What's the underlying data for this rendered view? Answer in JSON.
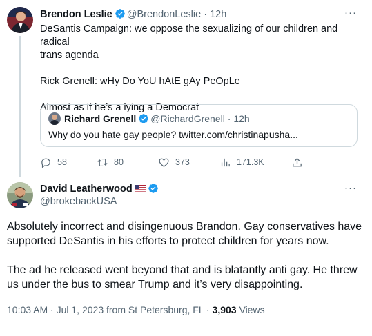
{
  "tweet1": {
    "author_name": "Brendon Leslie",
    "handle": "@BrendonLeslie",
    "separator": "·",
    "time": "12h",
    "more": "···",
    "lines": [
      "DeSantis Campaign: we oppose the sexualizing of our children and radical",
      "trans agenda",
      "",
      "Rick Grenell: wHy Do YoU hAtE gAy PeOpLe",
      "",
      "Almost as if he’s a lying a Democrat"
    ],
    "quote": {
      "author_name": "Richard Grenell",
      "handle": "@RichardGrenell",
      "separator": "·",
      "time": "12h",
      "text": "Why do you hate gay people? twitter.com/christinapusha..."
    },
    "actions": {
      "replies": "58",
      "retweets": "80",
      "likes": "373",
      "views": "171.3K"
    }
  },
  "tweet2": {
    "author_name": "David Leatherwood",
    "handle": "@brokebackUSA",
    "more": "···",
    "lines": [
      "Absolutely incorrect and disingenuous Brandon. Gay conservatives have",
      "supported DeSantis in his efforts to protect children for years now.",
      "",
      "The ad he released went beyond that and is blatantly anti gay. He threw",
      "us under the bus to smear Trump and it’s very disappointing."
    ],
    "meta": {
      "time": "10:03 AM",
      "separator1": "·",
      "date": "Jul 1, 2023",
      "location": "from St Petersburg, FL",
      "separator2": "·",
      "views_count": "3,903",
      "views_label": "Views"
    }
  },
  "colors": {
    "text": "#0f1419",
    "muted": "#536471",
    "verified_blue": "#1d9bf0",
    "border": "#cfd9de"
  }
}
